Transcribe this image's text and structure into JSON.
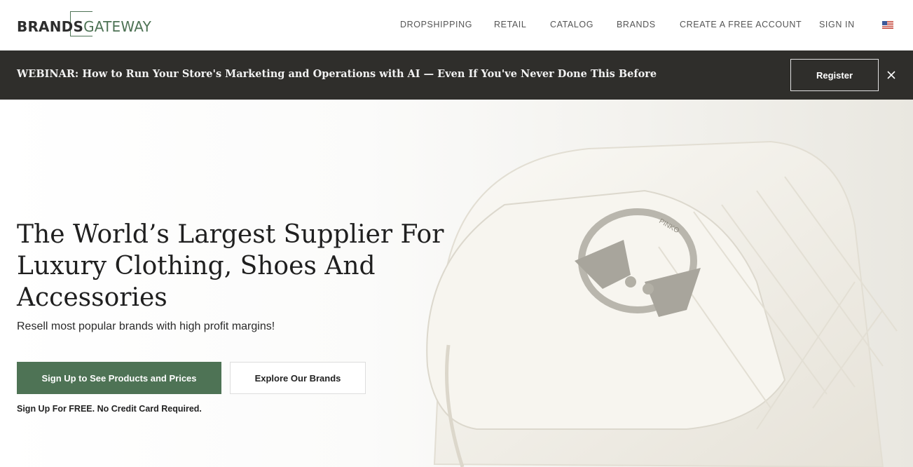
{
  "header": {
    "logo_brands": "BRANDS",
    "logo_gateway": "GATEWAY",
    "nav": [
      {
        "label": "DROPSHIPPING"
      },
      {
        "label": "RETAIL"
      },
      {
        "label": "CATALOG"
      },
      {
        "label": "BRANDS"
      },
      {
        "label": "CREATE A FREE ACCOUNT"
      },
      {
        "label": "SIGN IN"
      }
    ],
    "flag_icon": "us-flag-icon"
  },
  "banner": {
    "text": "WEBINAR: How to Run Your Store's Marketing and Operations with AI — Even If You've Never Done This Before",
    "register_label": "Register",
    "close_icon": "close-icon"
  },
  "hero": {
    "headline": "The World’s Largest Supplier For Luxury Clothing, Shoes And Accessories",
    "subline": "Resell most popular brands with high profit margins!",
    "signup_label": "Sign Up to See Products and Prices",
    "explore_label": "Explore Our Brands",
    "note": "Sign Up For FREE. No Credit Card Required.",
    "image_icon": "handbag-image",
    "image_logo": "PINKO"
  },
  "colors": {
    "accent": "#4e7355",
    "banner_bg": "#2f2e2b"
  }
}
